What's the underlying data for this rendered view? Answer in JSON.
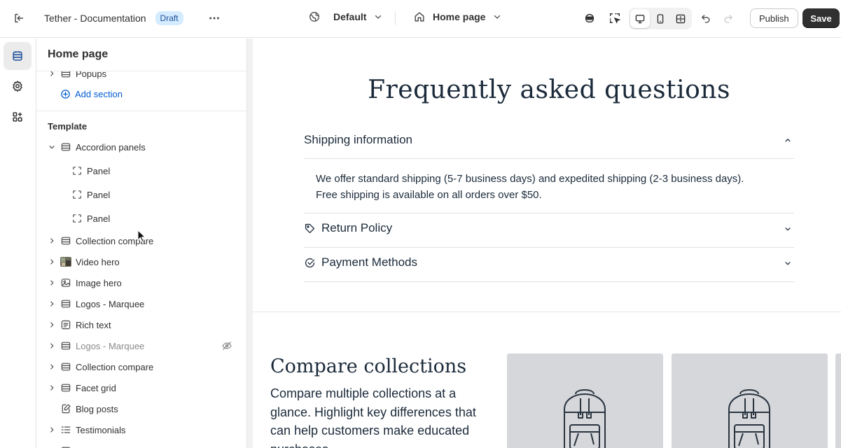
{
  "topbar": {
    "store_title": "Tether - Documentation",
    "status_badge": "Draft",
    "theme_dropdown": "Default",
    "page_dropdown": "Home page",
    "publish_label": "Publish",
    "save_label": "Save",
    "active_view": "desktop"
  },
  "sidebar": {
    "title": "Home page",
    "header_items": [
      {
        "label": "Popups",
        "icon": "section-icon",
        "expandable": true
      }
    ],
    "add_section_label": "Add section",
    "template_label": "Template",
    "template_items": [
      {
        "label": "Accordion panels",
        "icon": "section-icon",
        "expanded": true
      },
      {
        "label": "Panel",
        "icon": "block-icon",
        "child": true
      },
      {
        "label": "Panel",
        "icon": "block-icon",
        "child": true
      },
      {
        "label": "Panel",
        "icon": "block-icon",
        "child": true
      },
      {
        "label": "Collection compare",
        "icon": "section-icon"
      },
      {
        "label": "Video hero",
        "icon": "video-thumbnail-icon"
      },
      {
        "label": "Image hero",
        "icon": "image-icon"
      },
      {
        "label": "Logos - Marquee",
        "icon": "section-icon"
      },
      {
        "label": "Rich text",
        "icon": "text-icon"
      },
      {
        "label": "Logos - Marquee",
        "icon": "section-icon",
        "hidden": true
      },
      {
        "label": "Collection compare",
        "icon": "section-icon"
      },
      {
        "label": "Facet grid",
        "icon": "section-icon"
      },
      {
        "label": "Blog posts",
        "icon": "blog-icon"
      },
      {
        "label": "Testimonials",
        "icon": "list-icon"
      }
    ]
  },
  "preview": {
    "faq_title": "Frequently asked questions",
    "accordion": [
      {
        "title": "Shipping information",
        "icon": null,
        "expanded": true,
        "body_line1": "We offer standard shipping (5-7 business days) and expedited shipping (2-3 business days).",
        "body_line2": "Free shipping is available on all orders over $50."
      },
      {
        "title": "Return Policy",
        "icon": "tag-icon",
        "expanded": false
      },
      {
        "title": "Payment Methods",
        "icon": "check-circle-icon",
        "expanded": false
      }
    ],
    "compare_title": "Compare collections",
    "compare_description": "Compare multiple collections at a glance. Highlight key differences that can help customers make educated purchases."
  },
  "colors": {
    "accent_link": "#005bd3",
    "save_button": "#303030",
    "draft_badge_bg": "#d5ebff",
    "heading_text": "#1b2a3a",
    "card_bg": "#d5d7da"
  }
}
